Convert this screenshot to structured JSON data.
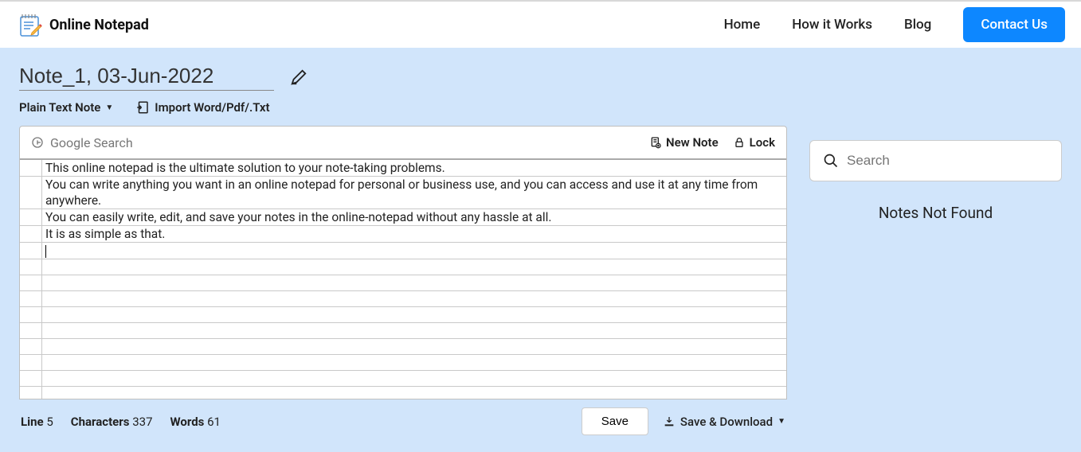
{
  "brand": {
    "name": "Online Notepad"
  },
  "nav": {
    "home": "Home",
    "how": "How it Works",
    "blog": "Blog",
    "contact": "Contact Us"
  },
  "note": {
    "title": "Note_1, 03-Jun-2022",
    "type_label": "Plain Text Note",
    "import_label": "Import Word/Pdf/.Txt"
  },
  "toolbar": {
    "gsearch_placeholder": "Google Search",
    "new_note": "New Note",
    "lock": "Lock"
  },
  "content": {
    "lines": [
      "This online notepad is the ultimate solution to your note-taking problems.",
      "You can write anything you want in an online notepad for personal or business use, and you can access and use it at any time from anywhere.",
      "You can easily write, edit, and save your notes in the online-notepad without any hassle at all.",
      "It is as simple as that."
    ]
  },
  "stats": {
    "line_label": "Line",
    "line_value": "5",
    "chars_label": "Characters",
    "chars_value": "337",
    "words_label": "Words",
    "words_value": "61"
  },
  "actions": {
    "save": "Save",
    "save_download": "Save & Download"
  },
  "sidebar": {
    "search_placeholder": "Search",
    "empty": "Notes Not Found"
  }
}
